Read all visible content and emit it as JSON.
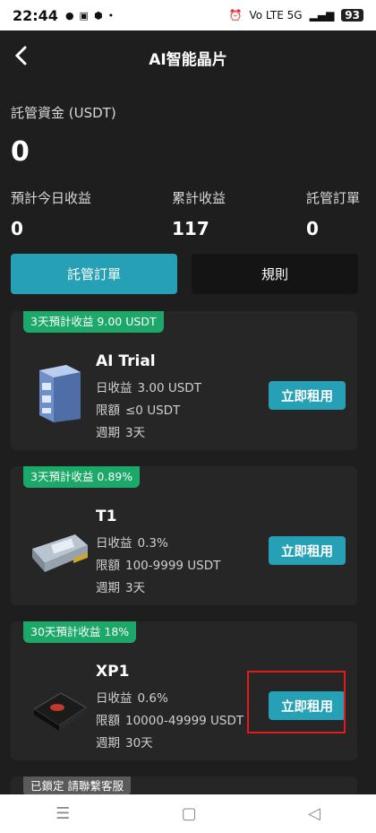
{
  "status": {
    "time": "22:44",
    "battery": "93",
    "signal_text": "Vo LTE 5G"
  },
  "header": {
    "title": "AI智能晶片"
  },
  "assets": {
    "label": "託管資金 (USDT)",
    "value": "0"
  },
  "stats": [
    {
      "label": "預計今日收益",
      "value": "0"
    },
    {
      "label": "累計收益",
      "value": "117"
    },
    {
      "label": "託管訂單",
      "value": "0"
    }
  ],
  "tabs": [
    {
      "label": "託管訂單"
    },
    {
      "label": "規則"
    }
  ],
  "cards": [
    {
      "badge": "3天預計收益 9.00 USDT",
      "name": "AI Trial",
      "rows": [
        {
          "label": "日收益",
          "value": "3.00 USDT"
        },
        {
          "label": "限額",
          "value": "≤0 USDT"
        },
        {
          "label": "週期",
          "value": "3天"
        }
      ],
      "button": "立即租用"
    },
    {
      "badge": "3天預計收益 0.89%",
      "name": "T1",
      "rows": [
        {
          "label": "日收益",
          "value": "0.3%"
        },
        {
          "label": "限額",
          "value": "100-9999 USDT"
        },
        {
          "label": "週期",
          "value": "3天"
        }
      ],
      "button": "立即租用"
    },
    {
      "badge": "30天預計收益 18%",
      "name": "XP1",
      "rows": [
        {
          "label": "日收益",
          "value": "0.6%"
        },
        {
          "label": "限額",
          "value": "10000-49999 USDT"
        },
        {
          "label": "週期",
          "value": "30天"
        }
      ],
      "button": "立即租用"
    }
  ],
  "locked": {
    "badge": "已鎖定 請聯繫客服"
  },
  "icons": [
    "back-arrow-icon",
    "server-icon",
    "gpu-card-icon",
    "chip-icon",
    "menu-icon",
    "home-icon",
    "back-nav-icon"
  ],
  "colors": {
    "accent": "#26a0b4",
    "badge_green": "#1ba868",
    "highlight": "#e21a1a"
  }
}
